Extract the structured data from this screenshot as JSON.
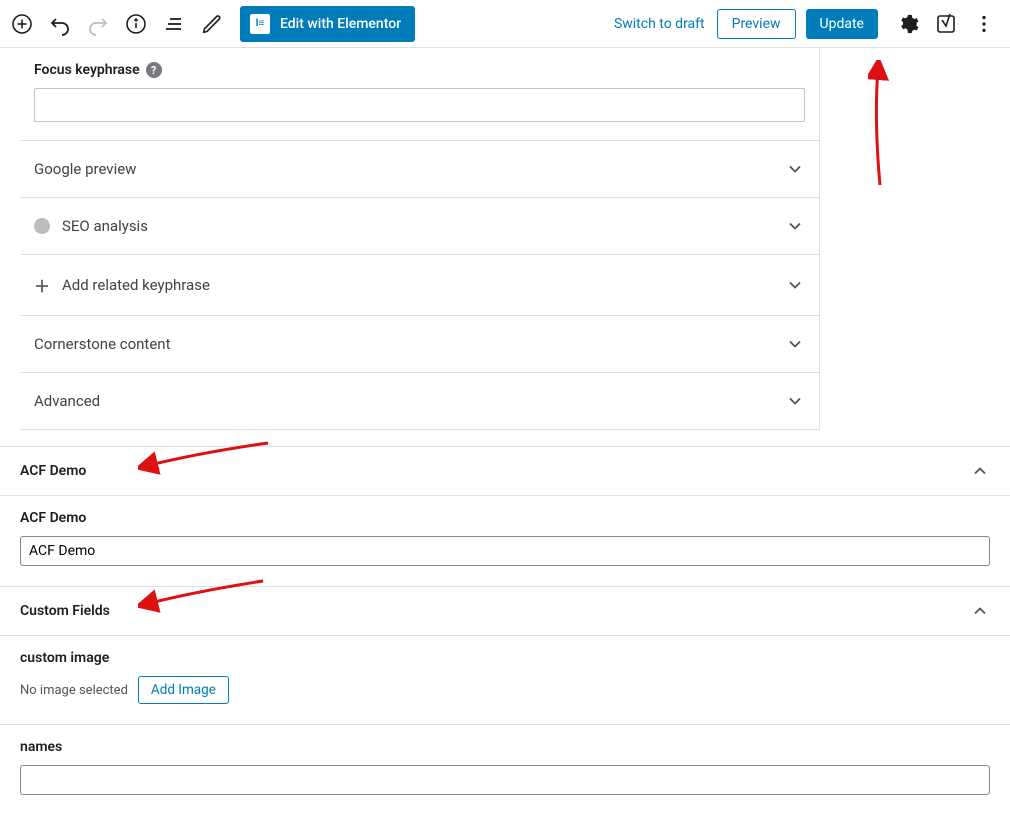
{
  "toolbar": {
    "elementor_label": "Edit with Elementor",
    "switch_draft": "Switch to draft",
    "preview": "Preview",
    "update": "Update"
  },
  "yoast": {
    "focus_label": "Focus keyphrase",
    "google_preview": "Google preview",
    "seo_analysis": "SEO analysis",
    "add_related": "Add related keyphrase",
    "cornerstone": "Cornerstone content",
    "advanced": "Advanced"
  },
  "acf_panel": {
    "header": "ACF Demo",
    "field_label": "ACF Demo",
    "field_value": "ACF Demo"
  },
  "cf_panel": {
    "header": "Custom Fields",
    "ci_label": "custom image",
    "ci_text": "No image selected",
    "add_image": "Add Image",
    "names_label": "names"
  }
}
